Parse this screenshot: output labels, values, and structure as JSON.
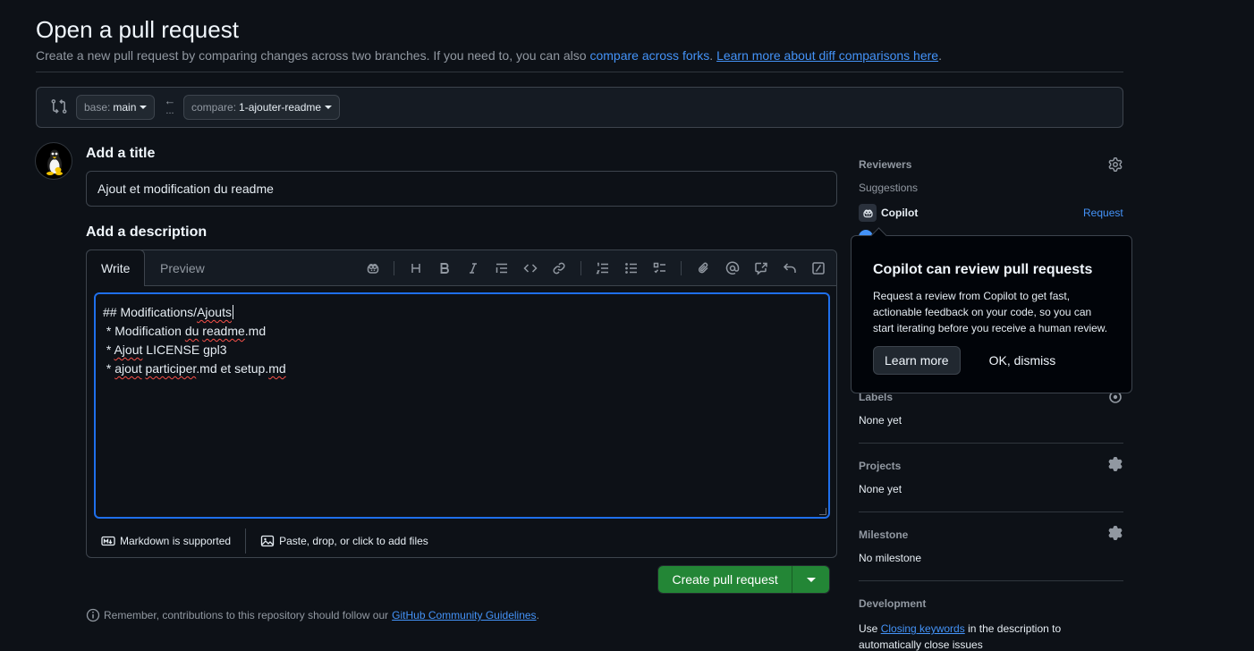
{
  "page": {
    "title": "Open a pull request",
    "subtitle_text": "Create a new pull request by comparing changes across two branches. If you need to, you can also",
    "subtitle_link1": "compare across forks",
    "subtitle_link2": "Learn more about diff comparisons here",
    "subtitle_sep": ".",
    "subtitle_end": "."
  },
  "range": {
    "base_prefix": "base:",
    "base_value": "main",
    "compare_prefix": "compare:",
    "compare_value": "1-ajouter-readme",
    "arrow": "←",
    "dots": "..."
  },
  "form": {
    "title_label": "Add a title",
    "title_value": "Ajout et modification du readme",
    "desc_label": "Add a description",
    "tab_write": "Write",
    "tab_preview": "Preview",
    "desc_lines": [
      {
        "pre": "## Modifications/",
        "err": "Ajouts",
        "post": ""
      },
      {
        "pre": " * Modification ",
        "err": "du",
        "mid": " ",
        "err2": "readme",
        "post": ".md"
      },
      {
        "pre": " * ",
        "err": "Ajout",
        "post": " LICENSE gpl3"
      },
      {
        "pre": " * ",
        "err": "ajout",
        "mid": " ",
        "err2": "participer",
        "post": ".md et setup.",
        "err3": "md"
      }
    ],
    "markdown_note": "Markdown is supported",
    "files_note": "Paste, drop, or click to add files",
    "create_button": "Create pull request",
    "remember_text": "Remember, contributions to this repository should follow our",
    "remember_link": "GitHub Community Guidelines",
    "remember_end": "."
  },
  "sidebar": {
    "reviewers_label": "Reviewers",
    "suggestions_label": "Suggestions",
    "copilot_name": "Copilot",
    "request_label": "Request",
    "labels_label": "Labels",
    "labels_value": "None yet",
    "projects_label": "Projects",
    "projects_value": "None yet",
    "milestone_label": "Milestone",
    "milestone_value": "No milestone",
    "development_label": "Development",
    "dev_text_pre": "Use",
    "dev_link": "Closing keywords",
    "dev_text_post": "in the description to",
    "dev_text_line2": "automatically close issues"
  },
  "popover": {
    "title": "Copilot can review pull requests",
    "body": "Request a review from Copilot to get fast, actionable feedback on your code, so you can start iterating before you receive a human review.",
    "learn_more": "Learn more",
    "dismiss": "OK, dismiss"
  },
  "icons": [
    "git-compare-icon",
    "arrow-left-icon",
    "copilot-icon",
    "heading-icon",
    "bold-icon",
    "italic-icon",
    "quote-icon",
    "code-icon",
    "link-icon",
    "ordered-list-icon",
    "unordered-list-icon",
    "task-list-icon",
    "attach-icon",
    "mention-icon",
    "cross-reference-icon",
    "undo-icon",
    "slash-command-icon",
    "markdown-icon",
    "image-icon",
    "info-icon",
    "gear-icon"
  ],
  "colors": {
    "accent": "#4493f8",
    "primary_button": "#238636",
    "focus": "#1f6feb",
    "background": "#0d1117"
  }
}
